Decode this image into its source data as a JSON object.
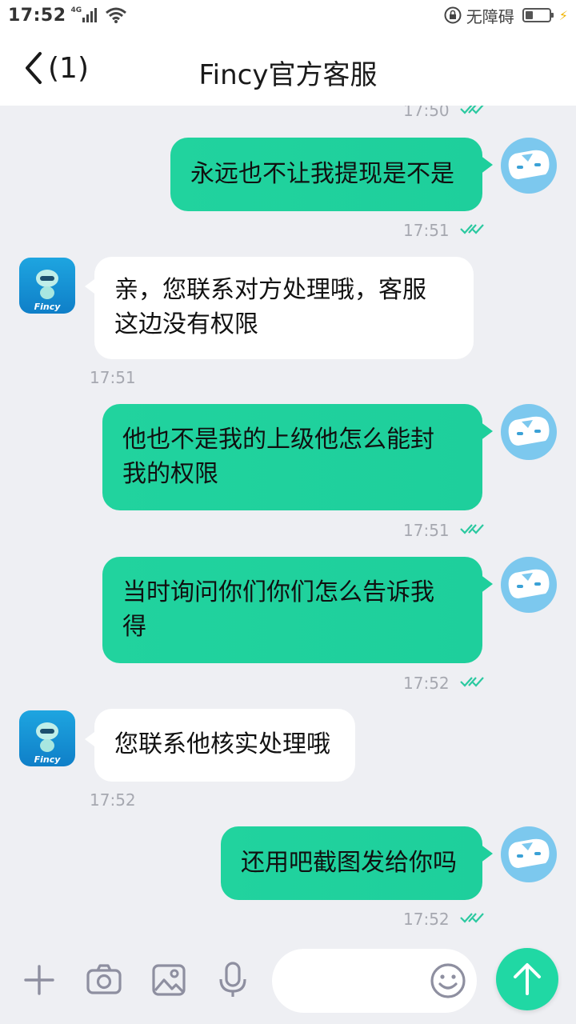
{
  "status_bar": {
    "time": "17:52",
    "network": "4G",
    "accessibility_label": "无障碍"
  },
  "header": {
    "back_count": "(1)",
    "title": "Fincy官方客服"
  },
  "colors": {
    "outgoing_bubble": "#1ecf9c",
    "incoming_bubble": "#ffffff",
    "chat_background": "#eeeff3",
    "send_button": "#20d8a4",
    "tick": "#2bc9a0"
  },
  "messages": [
    {
      "direction": "out",
      "lines": [
        "永远也不让我提现是不是"
      ],
      "time": "17:51",
      "read": true
    },
    {
      "direction": "in",
      "lines": [
        "亲，您联系对方处理哦，客服",
        "这边没有权限"
      ],
      "time": "17:51"
    },
    {
      "direction": "out",
      "lines": [
        "他也不是我的上级他怎么能封",
        "我的权限"
      ],
      "time": "17:51",
      "read": true
    },
    {
      "direction": "out",
      "lines": [
        "当时询问你们你们怎么告诉我",
        "得"
      ],
      "time": "17:52",
      "read": true
    },
    {
      "direction": "in",
      "lines": [
        "您联系他核实处理哦"
      ],
      "time": "17:52"
    },
    {
      "direction": "out",
      "lines": [
        "还用吧截图发给你吗"
      ],
      "time": "17:52",
      "read": true
    }
  ],
  "partial_top_time": "17:50",
  "agent_avatar_text": "Fincy",
  "input": {
    "value": "",
    "placeholder": ""
  },
  "icons": [
    "plus-icon",
    "camera-icon",
    "image-icon",
    "microphone-icon",
    "emoji-icon",
    "send-arrow-icon",
    "back-arrow-icon",
    "wifi-icon",
    "lock-icon",
    "battery-icon"
  ]
}
